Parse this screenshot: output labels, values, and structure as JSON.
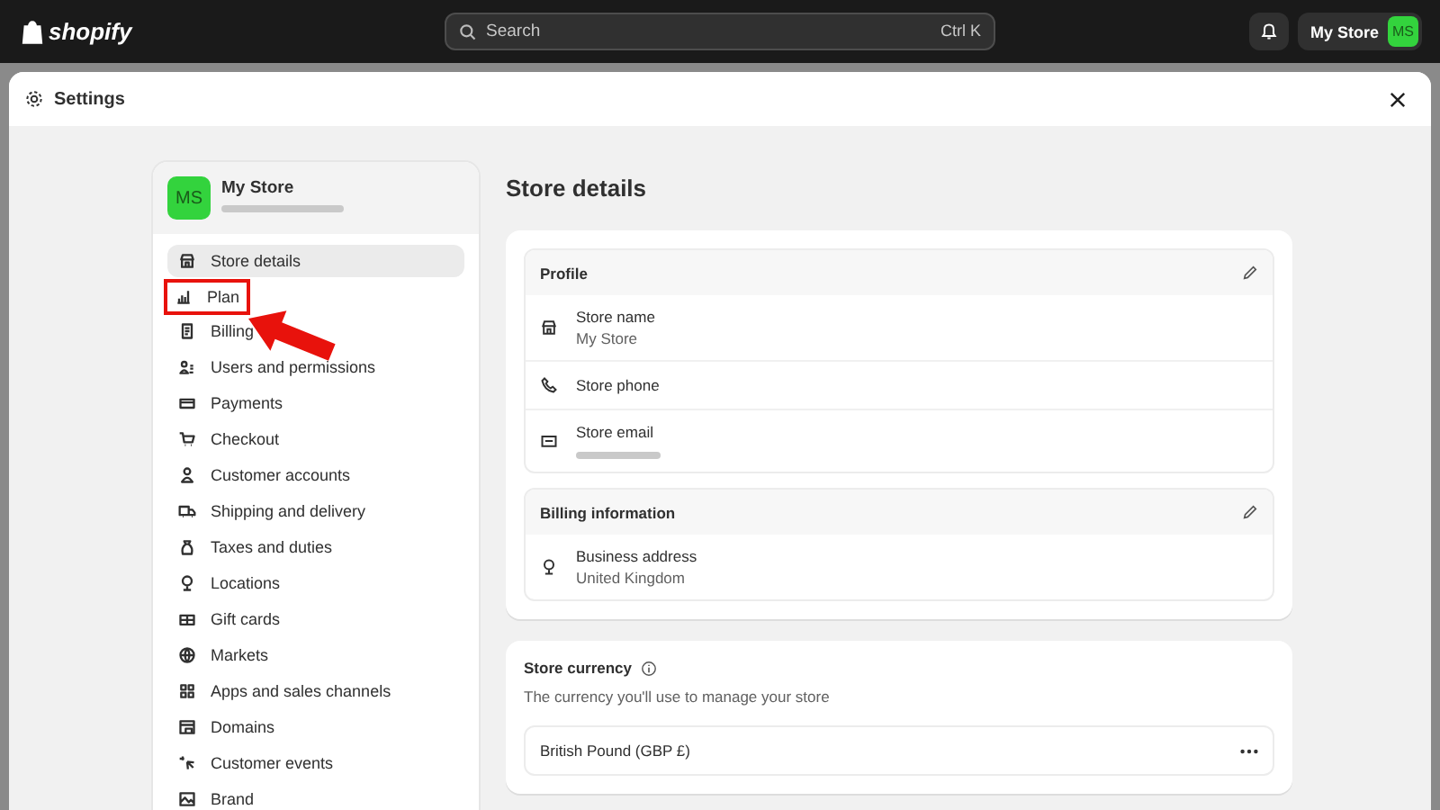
{
  "topbar": {
    "logo": "shopify",
    "search": {
      "placeholder": "Search",
      "shortcut": "Ctrl K"
    },
    "store_button": {
      "label": "My Store",
      "avatar": "MS"
    }
  },
  "modal": {
    "title": "Settings"
  },
  "sidebar": {
    "store": {
      "avatar": "MS",
      "name": "My Store",
      "handle_redacted": true
    },
    "items": [
      {
        "label": "Store details",
        "selected": true,
        "highlighted": false
      },
      {
        "label": "Plan",
        "selected": false,
        "highlighted": true
      },
      {
        "label": "Billing",
        "selected": false,
        "highlighted": false
      },
      {
        "label": "Users and permissions",
        "selected": false,
        "highlighted": false
      },
      {
        "label": "Payments",
        "selected": false,
        "highlighted": false
      },
      {
        "label": "Checkout",
        "selected": false,
        "highlighted": false
      },
      {
        "label": "Customer accounts",
        "selected": false,
        "highlighted": false
      },
      {
        "label": "Shipping and delivery",
        "selected": false,
        "highlighted": false
      },
      {
        "label": "Taxes and duties",
        "selected": false,
        "highlighted": false
      },
      {
        "label": "Locations",
        "selected": false,
        "highlighted": false
      },
      {
        "label": "Gift cards",
        "selected": false,
        "highlighted": false
      },
      {
        "label": "Markets",
        "selected": false,
        "highlighted": false
      },
      {
        "label": "Apps and sales channels",
        "selected": false,
        "highlighted": false
      },
      {
        "label": "Domains",
        "selected": false,
        "highlighted": false
      },
      {
        "label": "Customer events",
        "selected": false,
        "highlighted": false
      },
      {
        "label": "Brand",
        "selected": false,
        "highlighted": false
      }
    ]
  },
  "main": {
    "title": "Store details",
    "sections": [
      {
        "title": "Profile",
        "rows": [
          {
            "kind": "store",
            "label": "Store name",
            "value": "My Store"
          },
          {
            "kind": "phone",
            "label": "Store phone"
          },
          {
            "kind": "email",
            "label": "Store email",
            "redacted": true
          }
        ]
      },
      {
        "title": "Billing information",
        "rows": [
          {
            "kind": "address",
            "label": "Business address",
            "value": "United Kingdom"
          }
        ]
      }
    ],
    "currency": {
      "title": "Store currency",
      "description": "The currency you'll use to manage your store",
      "value": "British Pound (GBP £)"
    }
  }
}
